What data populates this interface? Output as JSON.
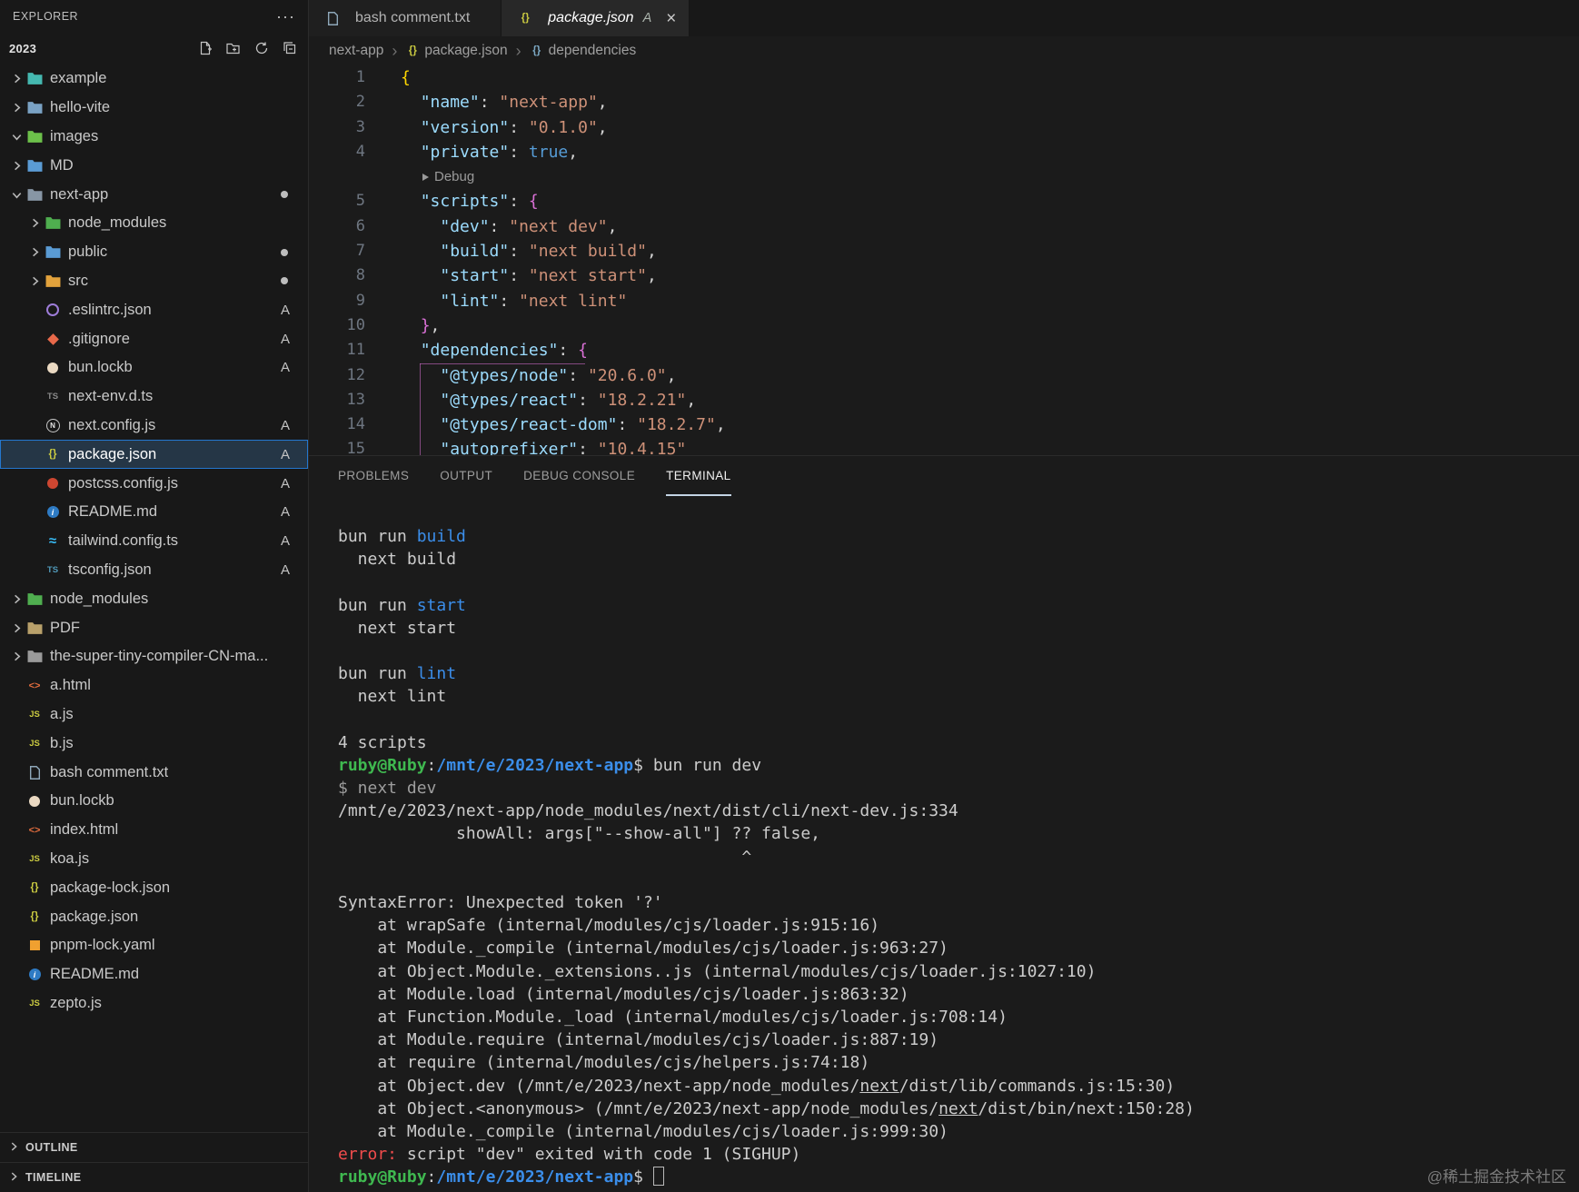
{
  "explorer": {
    "title": "EXPLORER",
    "more_label": "···",
    "workspace": "2023",
    "outline_label": "OUTLINE",
    "timeline_label": "TIMELINE",
    "tree": [
      {
        "label": "example",
        "level": 0,
        "kind": "folder",
        "icon": "folder",
        "color": "#45b8b0"
      },
      {
        "label": "hello-vite",
        "level": 0,
        "kind": "folder",
        "icon": "folder",
        "color": "#7aa2c4"
      },
      {
        "label": "images",
        "level": 0,
        "kind": "folder",
        "icon": "folder",
        "color": "#6cc04a",
        "expanded": true
      },
      {
        "label": "MD",
        "level": 0,
        "kind": "folder",
        "icon": "folder",
        "color": "#5a9bd4"
      },
      {
        "label": "next-app",
        "level": 0,
        "kind": "folder",
        "icon": "folder",
        "color": "#8796a5",
        "expanded": true,
        "dot": true
      },
      {
        "label": "node_modules",
        "level": 1,
        "kind": "folder",
        "icon": "folder",
        "color": "#4fae4f"
      },
      {
        "label": "public",
        "level": 1,
        "kind": "folder",
        "icon": "folder",
        "color": "#5a9bd4",
        "dot": true
      },
      {
        "label": "src",
        "level": 1,
        "kind": "folder",
        "icon": "folder",
        "color": "#e2a23c",
        "dot": true
      },
      {
        "label": ".eslintrc.json",
        "level": 1,
        "kind": "file",
        "icon": "eslint",
        "badge": "A"
      },
      {
        "label": ".gitignore",
        "level": 1,
        "kind": "file",
        "icon": "git",
        "badge": "A"
      },
      {
        "label": "bun.lockb",
        "level": 1,
        "kind": "file",
        "icon": "bun",
        "badge": "A"
      },
      {
        "label": "next-env.d.ts",
        "level": 1,
        "kind": "file",
        "icon": "ts-gray"
      },
      {
        "label": "next.config.js",
        "level": 1,
        "kind": "file",
        "icon": "next",
        "badge": "A"
      },
      {
        "label": "package.json",
        "level": 1,
        "kind": "file",
        "icon": "json",
        "badge": "A",
        "selected": true
      },
      {
        "label": "postcss.config.js",
        "level": 1,
        "kind": "file",
        "icon": "postcss",
        "badge": "A"
      },
      {
        "label": "README.md",
        "level": 1,
        "kind": "file",
        "icon": "readme",
        "badge": "A"
      },
      {
        "label": "tailwind.config.ts",
        "level": 1,
        "kind": "file",
        "icon": "tailwind",
        "badge": "A"
      },
      {
        "label": "tsconfig.json",
        "level": 1,
        "kind": "file",
        "icon": "ts",
        "badge": "A"
      },
      {
        "label": "node_modules",
        "level": 0,
        "kind": "folder",
        "icon": "folder",
        "color": "#4fae4f"
      },
      {
        "label": "PDF",
        "level": 0,
        "kind": "folder",
        "icon": "folder",
        "color": "#b8a06a"
      },
      {
        "label": "the-super-tiny-compiler-CN-ma...",
        "level": 0,
        "kind": "folder",
        "icon": "folder",
        "color": "#9a9a9a"
      },
      {
        "label": "a.html",
        "level": 0,
        "kind": "file",
        "icon": "html"
      },
      {
        "label": "a.js",
        "level": 0,
        "kind": "file",
        "icon": "js"
      },
      {
        "label": "b.js",
        "level": 0,
        "kind": "file",
        "icon": "js"
      },
      {
        "label": "bash comment.txt",
        "level": 0,
        "kind": "file",
        "icon": "txt"
      },
      {
        "label": "bun.lockb",
        "level": 0,
        "kind": "file",
        "icon": "bun"
      },
      {
        "label": "index.html",
        "level": 0,
        "kind": "file",
        "icon": "html"
      },
      {
        "label": "koa.js",
        "level": 0,
        "kind": "file",
        "icon": "js"
      },
      {
        "label": "package-lock.json",
        "level": 0,
        "kind": "file",
        "icon": "json"
      },
      {
        "label": "package.json",
        "level": 0,
        "kind": "file",
        "icon": "json"
      },
      {
        "label": "pnpm-lock.yaml",
        "level": 0,
        "kind": "file",
        "icon": "pnpm"
      },
      {
        "label": "README.md",
        "level": 0,
        "kind": "file",
        "icon": "readme"
      },
      {
        "label": "zepto.js",
        "level": 0,
        "kind": "file",
        "icon": "js"
      }
    ]
  },
  "editor": {
    "tabs": [
      {
        "icon": "txt",
        "label": "bash comment.txt",
        "active": false
      },
      {
        "icon": "json",
        "label": "package.json",
        "badge": "A",
        "active": true,
        "italic": true,
        "close": "×"
      }
    ],
    "breadcrumb": [
      {
        "label": "next-app"
      },
      {
        "icon": "json",
        "label": "package.json"
      },
      {
        "icon": "braces",
        "label": "dependencies"
      }
    ],
    "code": {
      "lines": [
        {
          "n": "1",
          "tokens": [
            [
              "{",
              "b1"
            ]
          ]
        },
        {
          "n": "2",
          "tokens": [
            [
              "  ",
              "p"
            ],
            [
              "\"name\"",
              "k"
            ],
            [
              ": ",
              "p"
            ],
            [
              "\"next-app\"",
              "s"
            ],
            [
              ",",
              "p"
            ]
          ]
        },
        {
          "n": "3",
          "tokens": [
            [
              "  ",
              "p"
            ],
            [
              "\"version\"",
              "k"
            ],
            [
              ": ",
              "p"
            ],
            [
              "\"0.1.0\"",
              "s"
            ],
            [
              ",",
              "p"
            ]
          ]
        },
        {
          "n": "4",
          "tokens": [
            [
              "  ",
              "p"
            ],
            [
              "\"private\"",
              "k"
            ],
            [
              ": ",
              "p"
            ],
            [
              "true",
              "kw"
            ],
            [
              ",",
              "p"
            ]
          ]
        },
        {
          "n": "",
          "lens": true,
          "tokens": [
            [
              "Debug",
              "lens"
            ]
          ]
        },
        {
          "n": "5",
          "tokens": [
            [
              "  ",
              "p"
            ],
            [
              "\"scripts\"",
              "k"
            ],
            [
              ": ",
              "p"
            ],
            [
              "{",
              "b2"
            ]
          ]
        },
        {
          "n": "6",
          "tokens": [
            [
              "    ",
              "p"
            ],
            [
              "\"dev\"",
              "k"
            ],
            [
              ": ",
              "p"
            ],
            [
              "\"next dev\"",
              "s"
            ],
            [
              ",",
              "p"
            ]
          ]
        },
        {
          "n": "7",
          "tokens": [
            [
              "    ",
              "p"
            ],
            [
              "\"build\"",
              "k"
            ],
            [
              ": ",
              "p"
            ],
            [
              "\"next build\"",
              "s"
            ],
            [
              ",",
              "p"
            ]
          ]
        },
        {
          "n": "8",
          "tokens": [
            [
              "    ",
              "p"
            ],
            [
              "\"start\"",
              "k"
            ],
            [
              ": ",
              "p"
            ],
            [
              "\"next start\"",
              "s"
            ],
            [
              ",",
              "p"
            ]
          ]
        },
        {
          "n": "9",
          "tokens": [
            [
              "    ",
              "p"
            ],
            [
              "\"lint\"",
              "k"
            ],
            [
              ": ",
              "p"
            ],
            [
              "\"next lint\"",
              "s"
            ]
          ]
        },
        {
          "n": "10",
          "tokens": [
            [
              "  ",
              "p"
            ],
            [
              "}",
              "b2"
            ],
            [
              ",",
              "p"
            ]
          ]
        },
        {
          "n": "11",
          "tokens": [
            [
              "  ",
              "p"
            ],
            [
              "\"dependencies\"",
              "k"
            ],
            [
              ": ",
              "p"
            ],
            [
              "{",
              "b2"
            ]
          ]
        },
        {
          "n": "12",
          "tokens": [
            [
              "    ",
              "p"
            ],
            [
              "\"@types/node\"",
              "k"
            ],
            [
              ": ",
              "p"
            ],
            [
              "\"20.6.0\"",
              "s"
            ],
            [
              ",",
              "p"
            ]
          ]
        },
        {
          "n": "13",
          "tokens": [
            [
              "    ",
              "p"
            ],
            [
              "\"@types/react\"",
              "k"
            ],
            [
              ": ",
              "p"
            ],
            [
              "\"18.2.21\"",
              "s"
            ],
            [
              ",",
              "p"
            ]
          ]
        },
        {
          "n": "14",
          "tokens": [
            [
              "    ",
              "p"
            ],
            [
              "\"@types/react-dom\"",
              "k"
            ],
            [
              ": ",
              "p"
            ],
            [
              "\"18.2.7\"",
              "s"
            ],
            [
              ",",
              "p"
            ]
          ]
        },
        {
          "n": "15",
          "tokens": [
            [
              "    ",
              "p"
            ],
            [
              "\"autoprefixer\"",
              "k"
            ],
            [
              ": ",
              "p"
            ],
            [
              "\"10.4.15\"",
              "s"
            ]
          ]
        }
      ]
    }
  },
  "panel": {
    "tabs": [
      {
        "label": "PROBLEMS"
      },
      {
        "label": "OUTPUT"
      },
      {
        "label": "DEBUG CONSOLE"
      },
      {
        "label": "TERMINAL",
        "active": true
      }
    ]
  },
  "terminal": {
    "lines": [
      [
        [
          "bun run ",
          "fg"
        ],
        [
          "build",
          "blue"
        ]
      ],
      [
        [
          "  next build",
          "fg"
        ]
      ],
      [],
      [
        [
          "bun run ",
          "fg"
        ],
        [
          "start",
          "blue"
        ]
      ],
      [
        [
          "  next start",
          "fg"
        ]
      ],
      [],
      [
        [
          "bun run ",
          "fg"
        ],
        [
          "lint",
          "blue"
        ]
      ],
      [
        [
          "  next lint",
          "fg"
        ]
      ],
      [],
      [
        [
          "4 scripts",
          "fg"
        ]
      ],
      [
        [
          "ruby@Ruby",
          "green"
        ],
        [
          ":",
          "fg"
        ],
        [
          "/mnt/e/2023/next-app",
          "path"
        ],
        [
          "$ ",
          "fg"
        ],
        [
          "bun run dev",
          "fg"
        ]
      ],
      [
        [
          "$ next dev",
          "dim"
        ]
      ],
      [
        [
          "/mnt/e/2023/next-app/node_modules/next/dist/cli/next-dev.js:334",
          "fg"
        ]
      ],
      [
        [
          "            showAll: args[\"--show-all\"] ?? false,",
          "fg"
        ]
      ],
      [
        [
          "                                         ^",
          "fg"
        ]
      ],
      [],
      [
        [
          "SyntaxError: Unexpected token '?'",
          "fg"
        ]
      ],
      [
        [
          "    at wrapSafe (internal/modules/cjs/loader.js:915:16)",
          "fg"
        ]
      ],
      [
        [
          "    at Module._compile (internal/modules/cjs/loader.js:963:27)",
          "fg"
        ]
      ],
      [
        [
          "    at Object.Module._extensions..js (internal/modules/cjs/loader.js:1027:10)",
          "fg"
        ]
      ],
      [
        [
          "    at Module.load (internal/modules/cjs/loader.js:863:32)",
          "fg"
        ]
      ],
      [
        [
          "    at Function.Module._load (internal/modules/cjs/loader.js:708:14)",
          "fg"
        ]
      ],
      [
        [
          "    at Module.require (internal/modules/cjs/loader.js:887:19)",
          "fg"
        ]
      ],
      [
        [
          "    at require (internal/modules/cjs/helpers.js:74:18)",
          "fg"
        ]
      ],
      [
        [
          "    at Object.dev (/mnt/e/2023/next-app/node_modules/",
          "fg"
        ],
        [
          "next",
          "fg u"
        ],
        [
          "/dist/lib/commands.js:15:30)",
          "fg"
        ]
      ],
      [
        [
          "    at Object.<anonymous> (/mnt/e/2023/next-app/node_modules/",
          "fg"
        ],
        [
          "next",
          "fg u"
        ],
        [
          "/dist/bin/next:150:28)",
          "fg"
        ]
      ],
      [
        [
          "    at Module._compile (internal/modules/cjs/loader.js:999:30)",
          "fg"
        ]
      ],
      [
        [
          "error:",
          "red"
        ],
        [
          " script \"dev\" exited with code 1 (SIGHUP)",
          "fg"
        ]
      ],
      [
        [
          "ruby@Ruby",
          "green"
        ],
        [
          ":",
          "fg"
        ],
        [
          "/mnt/e/2023/next-app",
          "path"
        ],
        [
          "$ ",
          "fg"
        ],
        [
          "",
          "cursor"
        ]
      ]
    ]
  },
  "watermark": {
    "text": "@稀土掘金技术社区"
  },
  "colors": {
    "sidebar_bg": "#181818",
    "editor_bg": "#1b1b1b",
    "selection_border": "#2477ce",
    "json_key": "#9cdcfe",
    "json_string": "#ce9178",
    "bracket_1": "#ffd700",
    "bracket_2": "#da70d6",
    "terminal_blue": "#3b8eea",
    "terminal_green": "#3fb950",
    "terminal_red": "#f14c4c"
  }
}
